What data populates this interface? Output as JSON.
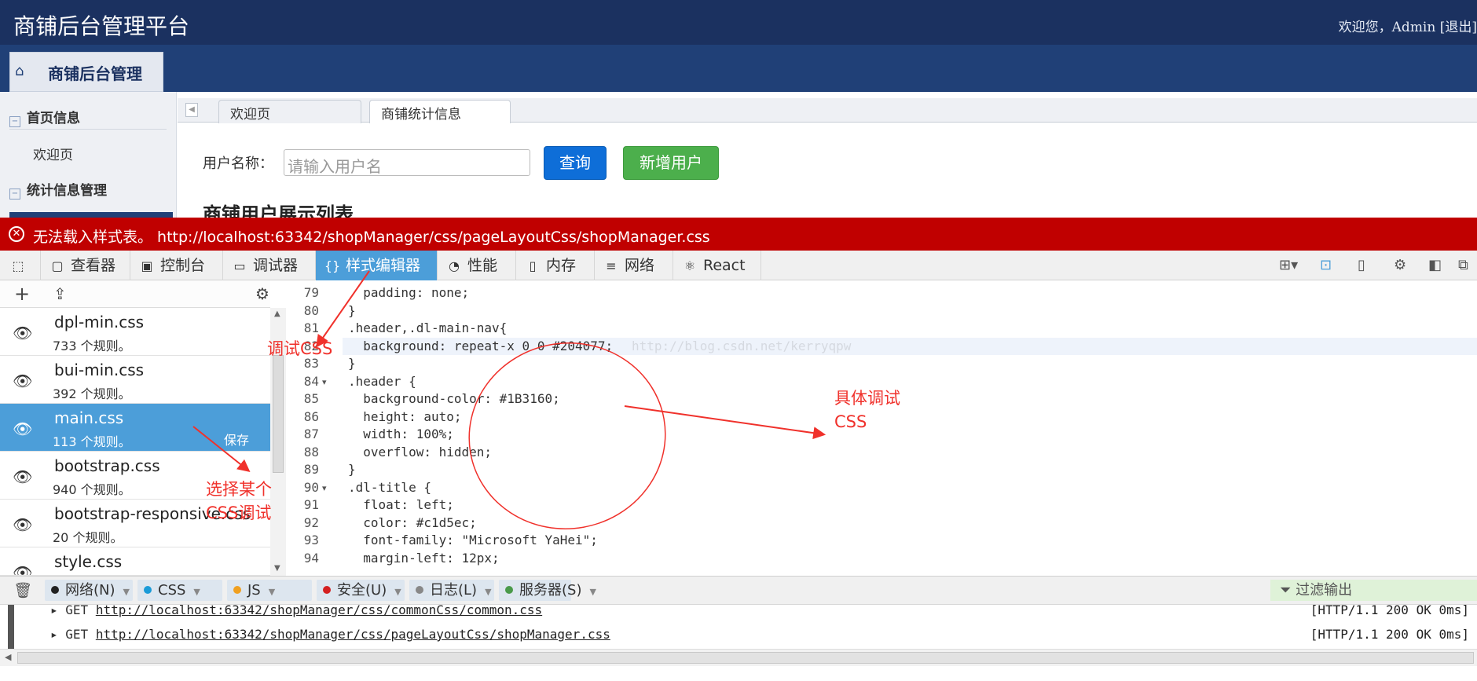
{
  "header": {
    "title": "商铺后台管理平台",
    "welcome": "欢迎您，Admin [退出]"
  },
  "nav": {
    "tab_label": "商铺后台管理"
  },
  "sidebar": {
    "groups": [
      {
        "label": "首页信息",
        "items": [
          "欢迎页"
        ]
      },
      {
        "label": "统计信息管理",
        "items": []
      }
    ]
  },
  "content_tabs": [
    "欢迎页",
    "商铺统计信息"
  ],
  "search": {
    "label": "用户名称：",
    "placeholder": "请输入用户名",
    "query_label": "查询",
    "add_label": "新增用户",
    "section_title": "商铺用户展示列表"
  },
  "error": {
    "message": "无法载入样式表。 http://localhost:63342/shopManager/css/pageLayoutCss/shopManager.css"
  },
  "devtools": {
    "tabs": [
      "查看器",
      "控制台",
      "调试器",
      "样式编辑器",
      "性能",
      "内存",
      "网络",
      "React"
    ],
    "active_tab": "样式编辑器"
  },
  "stylesheets": [
    {
      "name": "dpl-min.css",
      "rules": "733 个规则。"
    },
    {
      "name": "bui-min.css",
      "rules": "392 个规则。"
    },
    {
      "name": "main.css",
      "rules": "113 个规则。",
      "save": "保存",
      "selected": true
    },
    {
      "name": "bootstrap.css",
      "rules": "940 个规则。"
    },
    {
      "name": "bootstrap-responsive.css",
      "rules": "20 个规则。"
    },
    {
      "name": "style.css",
      "rules": ""
    }
  ],
  "editor": {
    "lines": [
      {
        "n": "79",
        "text": "  padding: none;"
      },
      {
        "n": "80",
        "text": "}"
      },
      {
        "n": "81",
        "text": ".header,.dl-main-nav{"
      },
      {
        "n": "82",
        "text": "  background: repeat-x 0 0 #204077;"
      },
      {
        "n": "83",
        "text": "}"
      },
      {
        "n": "84",
        "text": ".header {"
      },
      {
        "n": "85",
        "text": "  background-color: #1B3160;"
      },
      {
        "n": "86",
        "text": "  height: auto;"
      },
      {
        "n": "87",
        "text": "  width: 100%;"
      },
      {
        "n": "88",
        "text": "  overflow: hidden;"
      },
      {
        "n": "89",
        "text": "}"
      },
      {
        "n": "90",
        "text": ".dl-title {"
      },
      {
        "n": "91",
        "text": "  float: left;"
      },
      {
        "n": "92",
        "text": "  color: #c1d5ec;"
      },
      {
        "n": "93",
        "text": "  font-family: \"Microsoft YaHei\";"
      },
      {
        "n": "94",
        "text": "  margin-left: 12px;"
      }
    ],
    "watermark": "http://blog.csdn.net/kerryqpw"
  },
  "console": {
    "filters": [
      {
        "label": "网络(N)",
        "color": "#222222"
      },
      {
        "label": "CSS",
        "color": "#1a9bd8"
      },
      {
        "label": "JS",
        "color": "#f0a020"
      },
      {
        "label": "安全(U)",
        "color": "#d42020"
      },
      {
        "label": "日志(L)",
        "color": "#888888"
      },
      {
        "label": "服务器(S)",
        "color": "#4a9a4a"
      }
    ],
    "filter_output": "过滤输出",
    "requests": [
      {
        "method": "GET",
        "url": "http://localhost:63342/shopManager/css/commonCss/common.css",
        "status": "[HTTP/1.1 200 OK 0ms]"
      },
      {
        "method": "GET",
        "url": "http://localhost:63342/shopManager/css/pageLayoutCss/shopManager.css",
        "status": "[HTTP/1.1 200 OK 0ms]"
      }
    ]
  },
  "annotations": {
    "debug_css": "调试CSS",
    "specific_line1": "具体调试",
    "specific_line2": "CSS",
    "select_line1": "选择某个",
    "select_line2": "CSS调试"
  },
  "colors": {
    "header_bg": "#1b3160",
    "nav_bg": "#204077",
    "error_bg": "#c00000",
    "devtools_active": "#4c9ed9",
    "annotation": "#f0312b"
  }
}
